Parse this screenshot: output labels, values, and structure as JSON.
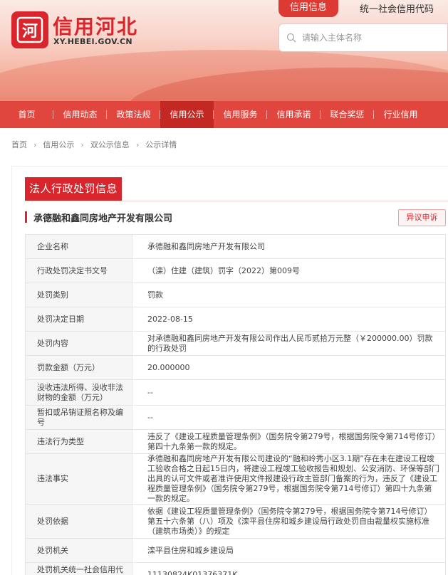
{
  "header": {
    "logo_glyph": "河",
    "logo_title": "信用河北",
    "logo_sub": "XY.HEBEI.GOV.CN",
    "tab_credit": "信用信息",
    "tab_code": "统一社会信用代码",
    "search_placeholder": "请输入主体名称"
  },
  "nav": [
    {
      "label": "首页"
    },
    {
      "label": "信用动态"
    },
    {
      "label": "政策法规"
    },
    {
      "label": "信用公示",
      "active": true
    },
    {
      "label": "信用服务"
    },
    {
      "label": "信用承诺"
    },
    {
      "label": "联合奖惩"
    },
    {
      "label": "行业信用"
    }
  ],
  "breadcrumb": [
    "首页",
    "信用公示",
    "双公示信息",
    "公示详情"
  ],
  "section": {
    "title": "法人行政处罚信息",
    "company": "承德融和鑫同房地产开发有限公司",
    "objection": "异议申诉"
  },
  "table": [
    {
      "label": "企业名称",
      "value": "承德融和鑫同房地产开发有限公司"
    },
    {
      "label": "行政处罚决定书文号",
      "value": "（滦）住建（建筑）罚字（2022）第009号"
    },
    {
      "label": "处罚类别",
      "value": "罚款"
    },
    {
      "label": "处罚决定日期",
      "value": "2022-08-15"
    },
    {
      "label": "处罚内容",
      "value": "对承德融和鑫同房地产开发有限公司作出人民币贰拾万元整（￥200000.00）罚款的行政处罚"
    },
    {
      "label": "罚款金额（万元）",
      "value": "20.000000"
    },
    {
      "label": "没收违法所得、没收非法财物的金额（万元）",
      "value": "--"
    },
    {
      "label": "暂扣或吊销证照名称及编号",
      "value": "--"
    },
    {
      "label": "违法行为类型",
      "value": "违反了《建设工程质量管理条例》（国务院令第279号，根据国务院令第714号修订）第四十九条第一款的规定。"
    },
    {
      "label": "违法事实",
      "value": "承德融和鑫同房地产开发有限公司建设的“融和岭秀小区3.1期”存在未在建设工程竣工验收合格之日起15日内，将建设工程竣工验收报告和规划、公安消防、环保等部门出具的认可文件或者准许使用文件报建设行政主管部门备案的行为，违反了《建设工程质量管理条例》（国务院令第279号，根据国务院令第714号修订）第四十九条第一款的规定。"
    },
    {
      "label": "处罚依据",
      "value": "依据《建设工程质量管理条例》（国务院令第279号，根据国务院令第714号修订）第五十六条第（八）项及《滦平县住房和城乡建设局行政处罚自由裁量权实施标准（建筑市场类）》的规定"
    },
    {
      "label": "处罚机关",
      "value": "滦平县住房和城乡建设局"
    },
    {
      "label": "处罚机关统一社会信用代码",
      "value": "11130824K01376371K"
    }
  ]
}
